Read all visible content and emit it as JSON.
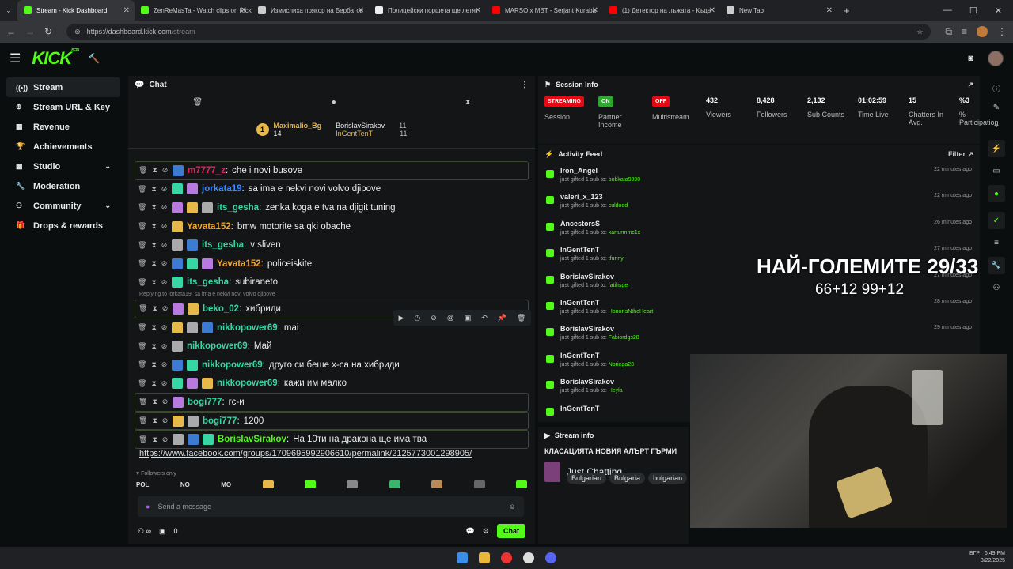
{
  "browser": {
    "tabs": [
      {
        "title": "Stream - Kick Dashboard",
        "color": "#53fc18",
        "active": true
      },
      {
        "title": "ZenReMasTa - Watch clips on Kick",
        "color": "#53fc18"
      },
      {
        "title": "Измислиха прякор на Бербатов",
        "color": "#cccccc"
      },
      {
        "title": "Полицейски поршета ще летят",
        "color": "#eeeeee"
      },
      {
        "title": "MARSO x MBT - Serjant Kuraba",
        "color": "#ff0000"
      },
      {
        "title": "(1) Детектор на лъжата - Къде",
        "color": "#ff0000"
      },
      {
        "title": "New Tab",
        "color": "#cccccc"
      }
    ],
    "url_host": "https://dashboard.kick.com",
    "url_path": "/stream"
  },
  "topnav": {
    "logo": "KICK",
    "beta": "BETA"
  },
  "sidebar": {
    "items": [
      {
        "label": "Stream",
        "icon": "broadcast-icon",
        "active": true
      },
      {
        "label": "Stream URL & Key",
        "icon": "link-icon"
      },
      {
        "label": "Revenue",
        "icon": "revenue-icon"
      },
      {
        "label": "Achievements",
        "icon": "trophy-icon"
      },
      {
        "label": "Studio",
        "icon": "studio-icon",
        "chevron": true
      },
      {
        "label": "Moderation",
        "icon": "wrench-icon"
      },
      {
        "label": "Community",
        "icon": "community-icon",
        "chevron": true
      },
      {
        "label": "Drops & rewards",
        "icon": "gift-icon"
      }
    ]
  },
  "chat": {
    "title": "Chat",
    "pinned": {
      "rank": "1",
      "top": "Maximalio_Bg",
      "top_count": "14",
      "second": "BorislavSirakov",
      "second_count": "11",
      "third": "InGentTenT",
      "third_count": "11"
    },
    "messages": [
      {
        "user": "m7777_z",
        "color": "#e0245e",
        "text": "che i novi busove",
        "bordered": true
      },
      {
        "user": "jorkata19",
        "color": "#3c8bff",
        "text": "sa ima e nekvi novi volvo djipove"
      },
      {
        "user": "its_gesha",
        "color": "#37d6a4",
        "text": "zenka koga e tva na djigit tuning"
      },
      {
        "user": "Yavata152",
        "color": "#f5a623",
        "text": "bmw motorite sa qki obache"
      },
      {
        "user": "its_gesha",
        "color": "#37d6a4",
        "text": "v sliven"
      },
      {
        "user": "Yavata152",
        "color": "#f5a623",
        "text": "policeiskite"
      },
      {
        "user": "its_gesha",
        "color": "#37d6a4",
        "text": "subiraneto"
      },
      {
        "user": "beko_02",
        "color": "#37d6a4",
        "text": "хибриди",
        "bordered": true
      },
      {
        "user": "nikkopower69",
        "color": "#37d6a4",
        "text": "mai"
      },
      {
        "user": "nikkopower69",
        "color": "#37d6a4",
        "text": "Май"
      },
      {
        "user": "nikkopower69",
        "color": "#37d6a4",
        "text": "друго си беше х-са на хибриди"
      },
      {
        "user": "nikkopower69",
        "color": "#37d6a4",
        "text": "кажи им малко"
      },
      {
        "user": "bogi777",
        "color": "#37d6a4",
        "text": "гс-и",
        "bordered": true
      },
      {
        "user": "bogi777",
        "color": "#37d6a4",
        "text": "1200",
        "bordered": true
      },
      {
        "user": "BorislavSirakov",
        "color": "#53fc18",
        "text": "На 10ти на дракона ще има тва",
        "bordered": true
      }
    ],
    "reply_note": "Replying to jorkata19: sa ima e nekvi novi volvo djipove",
    "link": "https://www.facebook.com/groups/1709695992906610/permalink/2125773001298905/",
    "followers_only": "Followers only",
    "emote_labels": [
      "POL",
      "NO",
      "MO"
    ],
    "input_placeholder": "Send a message",
    "bottom_count": "0",
    "send_label": "Chat"
  },
  "session": {
    "title": "Session Info",
    "pills": [
      {
        "pill": "STREAMING",
        "label": "Session",
        "color": "#e50914"
      },
      {
        "pill": "ON",
        "label": "Partner Income",
        "color": "#2fa82f"
      },
      {
        "pill": "OFF",
        "label": "Multistream",
        "color": "#e50914"
      }
    ],
    "stats": [
      {
        "value": "432",
        "label": "Viewers"
      },
      {
        "value": "8,428",
        "label": "Followers"
      },
      {
        "value": "2,132",
        "label": "Sub Counts"
      },
      {
        "value": "01:02:59",
        "label": "Time Live"
      },
      {
        "value": "15",
        "label": "Chatters In Avg."
      },
      {
        "value": "%3",
        "label": "% Participation"
      }
    ]
  },
  "activity": {
    "title": "Activity Feed",
    "filter": "Filter",
    "items": [
      {
        "who": "Iron_Angel",
        "to": "bobkata9090",
        "time": "22 minutes ago"
      },
      {
        "who": "valeri_x_123",
        "to": "culdood",
        "time": "22 minutes ago"
      },
      {
        "who": "AncestorsS",
        "to": "xarturmmc1x",
        "time": "26 minutes ago"
      },
      {
        "who": "InGentTenT",
        "to": "tfunny",
        "time": "27 minutes ago"
      },
      {
        "who": "BorislavSirakov",
        "to": "fatihsge",
        "time": "27 minutes ago"
      },
      {
        "who": "InGentTenT",
        "to": "HonorIsNtheHeart",
        "time": "28 minutes ago"
      },
      {
        "who": "BorislavSirakov",
        "to": "Fabiordgs28",
        "time": "29 minutes ago"
      },
      {
        "who": "InGentTenT",
        "to": "Noriega23",
        "time": ""
      },
      {
        "who": "BorislavSirakov",
        "to": "Heyla",
        "time": ""
      },
      {
        "who": "InGentTenT",
        "to": "",
        "time": ""
      }
    ],
    "prefix": "just gifted ",
    "mid": "1 sub to: "
  },
  "streaminfo": {
    "title": "Stream info",
    "stream_title": "КЛАСАЦИЯТА НОВИЯ АЛЪРТ ГЪРМИ",
    "category": "Just Chatting",
    "tags": [
      "Bulgarian",
      "Bulgaria",
      "bulgarian"
    ]
  },
  "overlay": {
    "line1": "НАЙ-ГОЛЕМИТЕ 29/33",
    "line2": "66+12 99+12"
  },
  "tray": {
    "time": "6:49 PM",
    "date": "3/22/2025",
    "lang": "БГР"
  }
}
